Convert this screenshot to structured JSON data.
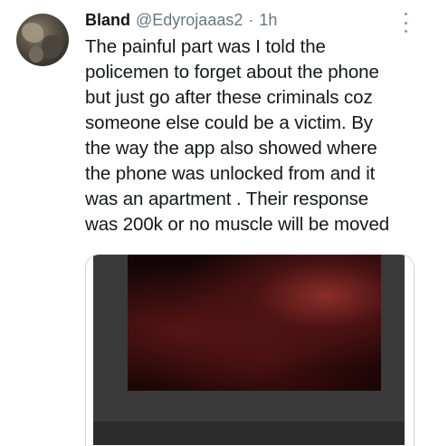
{
  "tweet": {
    "display_name": "Bland",
    "handle": "@Edyrojaaas2",
    "separator": "·",
    "time": "1h",
    "menu_icon": "more-vertical-icon",
    "text_lines": [
      "The painful part was I told the",
      "policemen to forget about the phone",
      "but just go after these criminals coz",
      "someone else could be a victim. By",
      "the way the app also showed where",
      "the phone was unlocked from and it",
      "was an apartment . Their response",
      "was 200k or no muscle will be moved"
    ]
  },
  "colors": {
    "name": "#14171a",
    "secondary": "#657786",
    "card_border": "#ccd6dd",
    "media_background": "#3a3a3a"
  }
}
